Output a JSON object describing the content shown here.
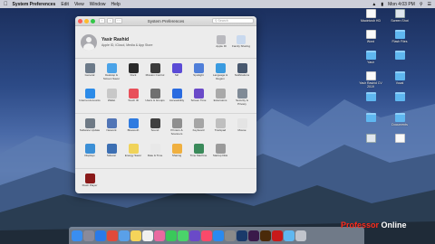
{
  "menubar": {
    "app": "System Preferences",
    "items": [
      "Edit",
      "View",
      "Window",
      "Help"
    ],
    "clock": "Mon 4:03 PM"
  },
  "window": {
    "title": "System Preferences",
    "search_placeholder": "Search"
  },
  "account": {
    "name": "Yasir Rashid",
    "subtitle": "Apple ID, iCloud, Media & App Store",
    "items": [
      {
        "label": "Apple ID",
        "color": "#b9b9be"
      },
      {
        "label": "Family Sharing",
        "color": "#c9d9ee"
      }
    ]
  },
  "sections": [
    {
      "rows": [
        [
          {
            "label": "General",
            "icon": "general-icon",
            "color": "#6c7a89"
          },
          {
            "label": "Desktop & Screen Saver",
            "icon": "desktop-icon",
            "color": "#4aa3e8"
          },
          {
            "label": "Dock",
            "icon": "dock-icon",
            "color": "#2a2a2a"
          },
          {
            "label": "Mission Control",
            "icon": "mission-control-icon",
            "color": "#3c3c3c"
          },
          {
            "label": "Siri",
            "icon": "siri-icon",
            "color": "#5b4bd6"
          },
          {
            "label": "Spotlight",
            "icon": "spotlight-icon",
            "color": "#4f7ed9"
          },
          {
            "label": "Language & Region",
            "icon": "globe-icon",
            "color": "#3a9be0"
          },
          {
            "label": "Notifications",
            "icon": "notifications-icon",
            "color": "#48586e"
          }
        ],
        [
          {
            "label": "Internet Accounts",
            "icon": "at-icon",
            "color": "#2c8be8"
          },
          {
            "label": "Wallet",
            "icon": "wallet-icon",
            "color": "#c8c8c8"
          },
          {
            "label": "Touch ID",
            "icon": "fingerprint-icon",
            "color": "#e8505a"
          },
          {
            "label": "Users & Groups",
            "icon": "users-icon",
            "color": "#707070"
          },
          {
            "label": "Accessibility",
            "icon": "accessibility-icon",
            "color": "#2a6be0"
          },
          {
            "label": "Screen Time",
            "icon": "hourglass-icon",
            "color": "#6a4ac8"
          },
          {
            "label": "Extensions",
            "icon": "puzzle-icon",
            "color": "#a9a9a9"
          },
          {
            "label": "Security & Privacy",
            "icon": "house-icon",
            "color": "#7f8a96"
          }
        ]
      ]
    },
    {
      "rows": [
        [
          {
            "label": "Software Update",
            "icon": "gear-icon",
            "color": "#6f7a86"
          },
          {
            "label": "Network",
            "icon": "network-icon",
            "color": "#5175b6"
          },
          {
            "label": "Bluetooth",
            "icon": "bluetooth-icon",
            "color": "#2f7be0"
          },
          {
            "label": "Sound",
            "icon": "speaker-icon",
            "color": "#3f3f3f"
          },
          {
            "label": "Printers & Scanners",
            "icon": "printer-icon",
            "color": "#8f8f8f"
          },
          {
            "label": "Keyboard",
            "icon": "keyboard-icon",
            "color": "#a5a5a5"
          },
          {
            "label": "Trackpad",
            "icon": "trackpad-icon",
            "color": "#bfbfbf"
          },
          {
            "label": "Mouse",
            "icon": "mouse-icon",
            "color": "#e4e4e4"
          }
        ],
        [
          {
            "label": "Displays",
            "icon": "display-icon",
            "color": "#3b8fd6"
          },
          {
            "label": "Sidecar",
            "icon": "sidecar-icon",
            "color": "#3c6fb3"
          },
          {
            "label": "Energy Saver",
            "icon": "bulb-icon",
            "color": "#f0d35a"
          },
          {
            "label": "Date & Time",
            "icon": "calendar-icon",
            "color": "#e8e8e8"
          },
          {
            "label": "Sharing",
            "icon": "sharing-icon",
            "color": "#f0b040"
          },
          {
            "label": "Time Machine",
            "icon": "time-machine-icon",
            "color": "#3a8a5a"
          },
          {
            "label": "Startup Disk",
            "icon": "disk-icon",
            "color": "#9a9a9a"
          }
        ]
      ]
    },
    {
      "rows": [
        [
          {
            "label": "Flash Player",
            "icon": "flash-icon",
            "color": "#8a1a1a"
          }
        ]
      ]
    }
  ],
  "desktop_items": [
    {
      "label": "Macintosh HD",
      "kind": "doc"
    },
    {
      "label": "Screen Shot",
      "kind": "shot"
    },
    {
      "label": "Word",
      "kind": "doc"
    },
    {
      "label": "Flash Files",
      "kind": "folder"
    },
    {
      "label": "Yasir",
      "kind": "folder"
    },
    {
      "label": "",
      "kind": "folder"
    },
    {
      "label": "Yasir Rashid CV 2019",
      "kind": "doc"
    },
    {
      "label": "Vocal",
      "kind": "folder"
    },
    {
      "label": "",
      "kind": "folder"
    },
    {
      "label": "",
      "kind": "folder"
    },
    {
      "label": "",
      "kind": "folder"
    },
    {
      "label": "Documents",
      "kind": "folder"
    },
    {
      "label": "",
      "kind": "shot"
    },
    {
      "label": "",
      "kind": "doc"
    }
  ],
  "dock": [
    {
      "name": "finder",
      "color": "#3a8ef0"
    },
    {
      "name": "launchpad",
      "color": "#8a8a9a"
    },
    {
      "name": "safari",
      "color": "#2a7ae8"
    },
    {
      "name": "chrome",
      "color": "#e04a3a"
    },
    {
      "name": "mail",
      "color": "#5aa0e8"
    },
    {
      "name": "notes",
      "color": "#f5d45a"
    },
    {
      "name": "reminders",
      "color": "#f0f0f0"
    },
    {
      "name": "photos",
      "color": "#e86aa0"
    },
    {
      "name": "facetime",
      "color": "#3ac85a"
    },
    {
      "name": "messages",
      "color": "#4ad46a"
    },
    {
      "name": "imovie",
      "color": "#6a4ac8"
    },
    {
      "name": "music",
      "color": "#fa4a6a"
    },
    {
      "name": "app-store",
      "color": "#2a8af0"
    },
    {
      "name": "system-prefs",
      "color": "#8a8a8a"
    },
    {
      "name": "photoshop",
      "color": "#1a3a6a"
    },
    {
      "name": "premiere",
      "color": "#3a1a4a"
    },
    {
      "name": "illustrator",
      "color": "#4a2a0a"
    },
    {
      "name": "acrobat",
      "color": "#c81a1a"
    },
    {
      "name": "folder",
      "color": "#5fb7f0"
    },
    {
      "name": "trash",
      "color": "#c0c4cc"
    }
  ],
  "watermark": {
    "part1": "Professor",
    "part2": "Online"
  }
}
